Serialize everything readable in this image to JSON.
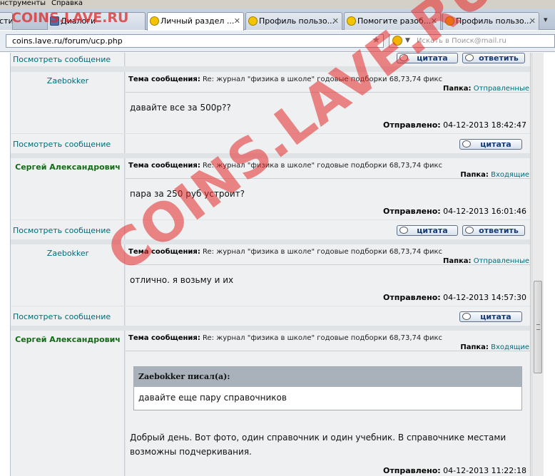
{
  "menubar": {
    "items": [
      "нструменты",
      "Справка"
    ]
  },
  "tabs": [
    {
      "label": "сти"
    },
    {
      "label": "Диалоги"
    },
    {
      "label": "Личный раздел ..."
    },
    {
      "label": "Профиль пользо..."
    },
    {
      "label": "Помогите разоб..."
    },
    {
      "label": "Профиль пользо..."
    }
  ],
  "address": {
    "url": "coins.lave.ru/forum/ucp.php",
    "search_placeholder": "Искать в Поиск@mail.ru"
  },
  "watermark": {
    "text": "COINS.LAVE.RU"
  },
  "labels": {
    "view": "Посмотреть сообщение",
    "quote": "цитата",
    "reply": "ответить",
    "subject_label": "Тема сообщения:",
    "folder_label": "Папка:",
    "sent_label": "Отправлено:"
  },
  "messages": [
    {
      "author": "Zaebokker",
      "subject": "Re: журнал \"физика в школе\" годовые подборки 68,73,74 фикс",
      "folder": "Отправленные",
      "body": "давайте все за 500р??",
      "sent": "04-12-2013 18:42:47"
    },
    {
      "author": "Сергей Александрович",
      "subject": "Re: журнал \"физика в школе\" годовые подборки 68,73,74 фикс",
      "folder": "Входящие",
      "body": "пара за 250 руб устроит?",
      "sent": "04-12-2013 16:01:46"
    },
    {
      "author": "Zaebokker",
      "subject": "Re: журнал \"физика в школе\" годовые подборки 68,73,74 фикс",
      "folder": "Отправленные",
      "body": "отлично. я возьму и их",
      "sent": "04-12-2013 14:57:30"
    },
    {
      "author": "Сергей Александрович",
      "subject": "Re: журнал \"физика в школе\" годовые подборки 68,73,74 фикс",
      "folder": "Входящие",
      "quote_author": "Zaebokker писал(а):",
      "quote_text": "давайте еще пару справочников",
      "body": "Добрый день. Вот фото, один справочник и один учебник. В справочнике местами возможны подчеркивания.",
      "sent": "04-12-2013 11:22:18"
    }
  ]
}
